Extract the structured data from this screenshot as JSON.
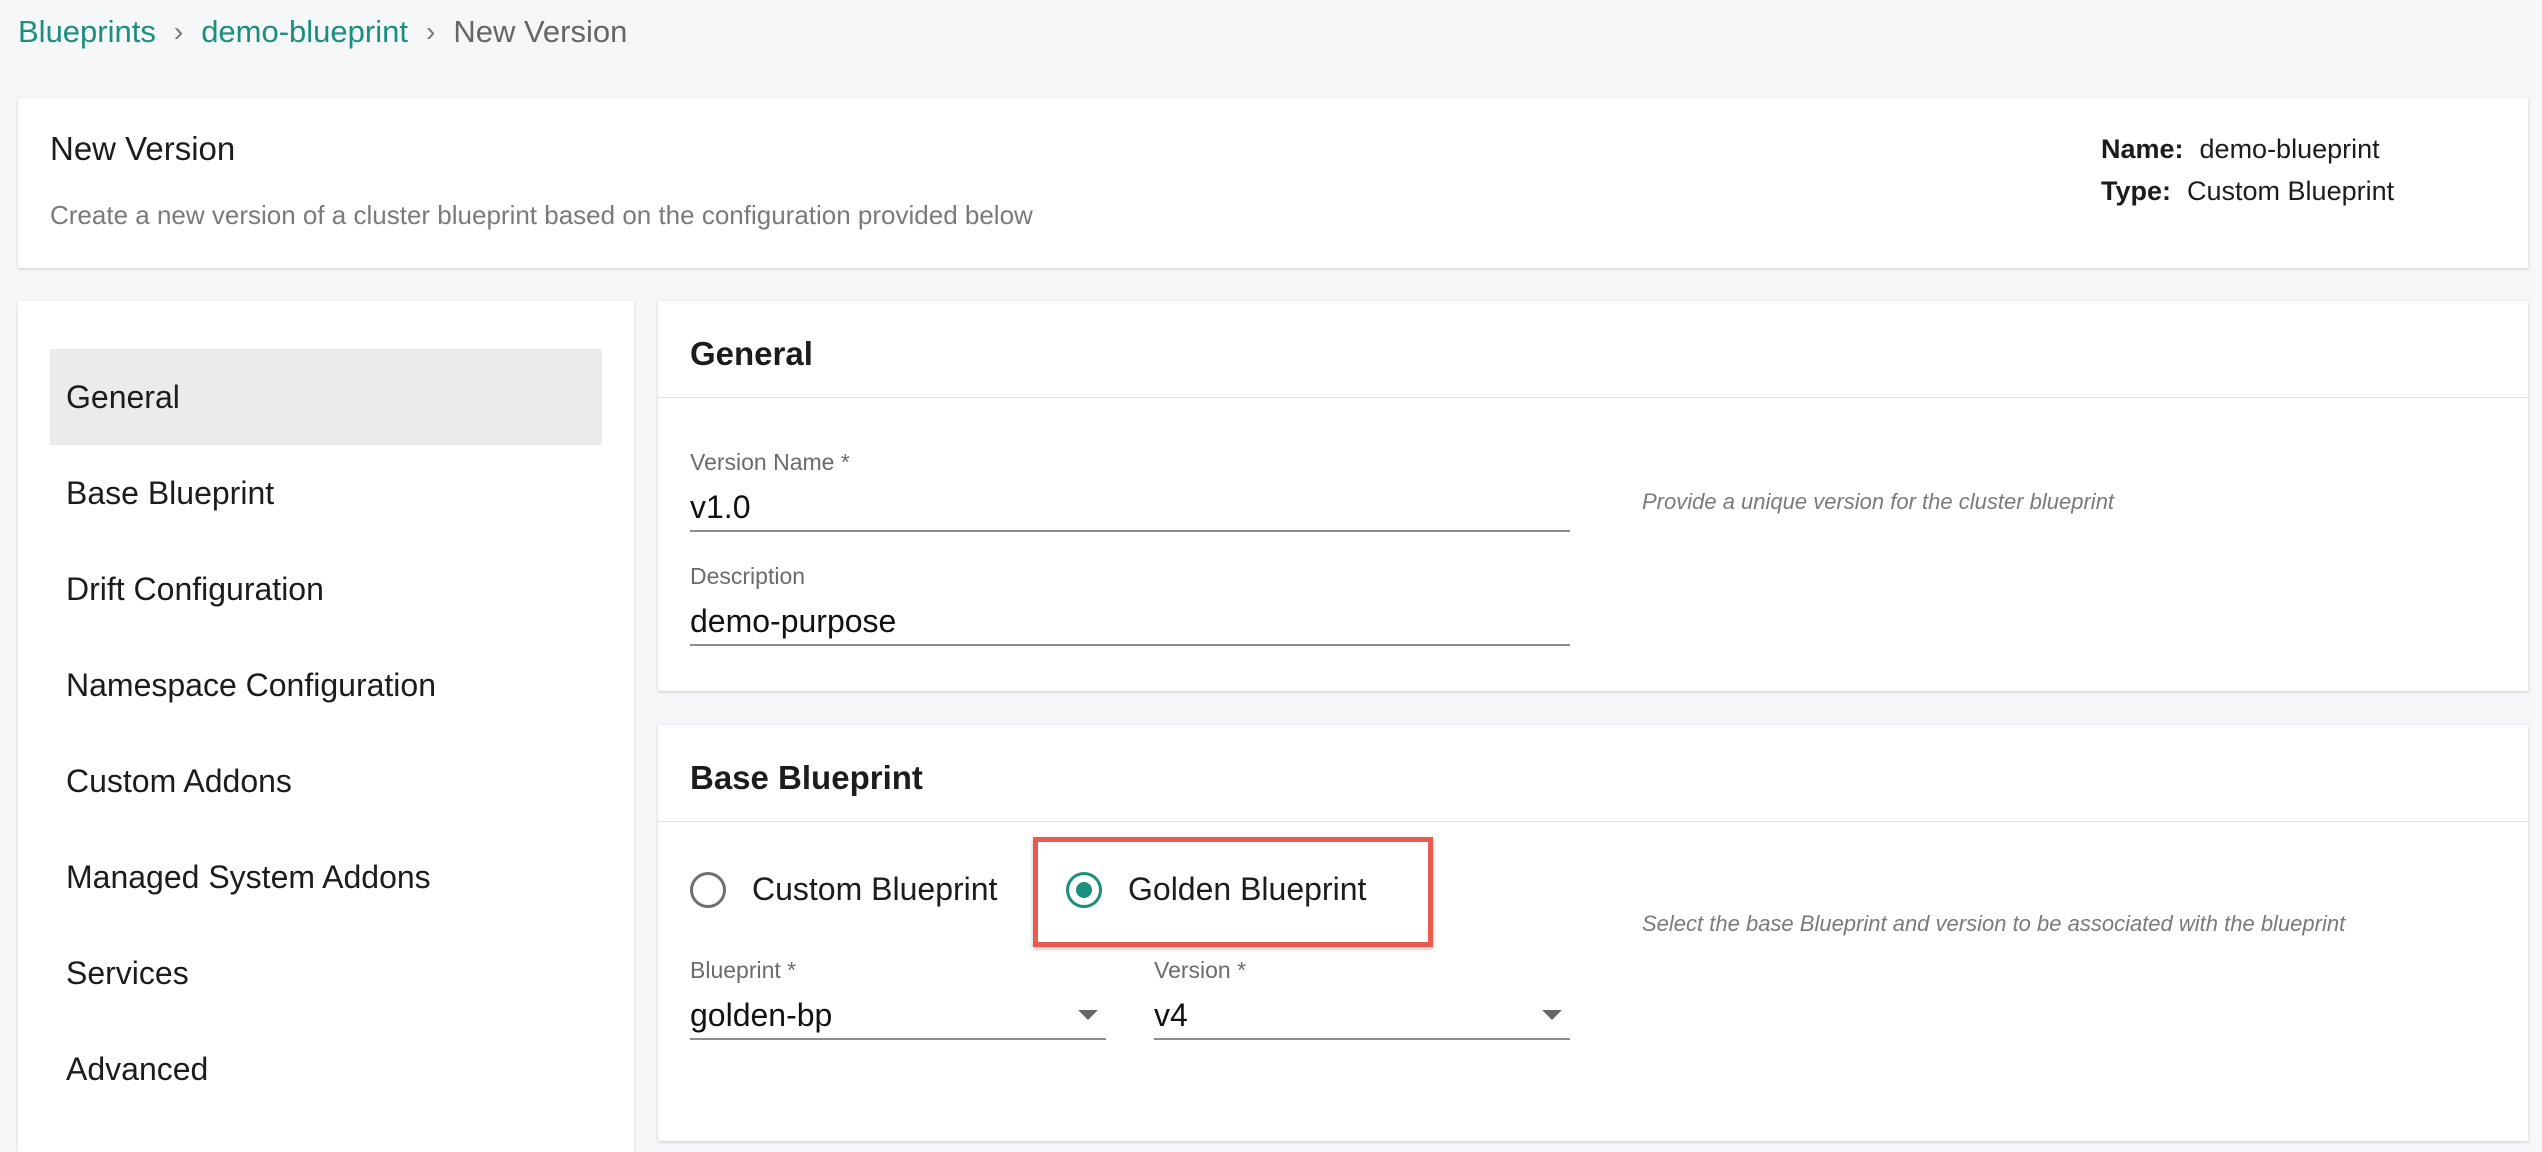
{
  "breadcrumb": {
    "items": [
      "Blueprints",
      "demo-blueprint"
    ],
    "separator": "›",
    "current": "New Version"
  },
  "header": {
    "title": "New Version",
    "subtitle": "Create a new version of a cluster blueprint based on the configuration provided below",
    "name_label": "Name:",
    "name_value": "demo-blueprint",
    "type_label": "Type:",
    "type_value": "Custom Blueprint"
  },
  "sidebar": {
    "items": [
      {
        "label": "General",
        "active": true
      },
      {
        "label": "Base Blueprint",
        "active": false
      },
      {
        "label": "Drift Configuration",
        "active": false
      },
      {
        "label": "Namespace Configuration",
        "active": false
      },
      {
        "label": "Custom Addons",
        "active": false
      },
      {
        "label": "Managed System Addons",
        "active": false
      },
      {
        "label": "Services",
        "active": false
      },
      {
        "label": "Advanced",
        "active": false
      }
    ]
  },
  "general": {
    "title": "General",
    "version_name_label": "Version Name *",
    "version_name_value": "v1.0",
    "version_hint": "Provide a unique version for the cluster blueprint",
    "description_label": "Description",
    "description_value": "demo-purpose"
  },
  "base_blueprint": {
    "title": "Base Blueprint",
    "options": [
      {
        "label": "Custom Blueprint",
        "selected": false
      },
      {
        "label": "Golden Blueprint",
        "selected": true
      }
    ],
    "hint": "Select the base Blueprint and version to be associated with the blueprint",
    "blueprint_label": "Blueprint *",
    "blueprint_value": "golden-bp",
    "version_label": "Version *",
    "version_value": "v4"
  },
  "colors": {
    "accent": "#1a8f7d",
    "highlight": "#ea5b4f",
    "background": "#f6f7f9"
  }
}
